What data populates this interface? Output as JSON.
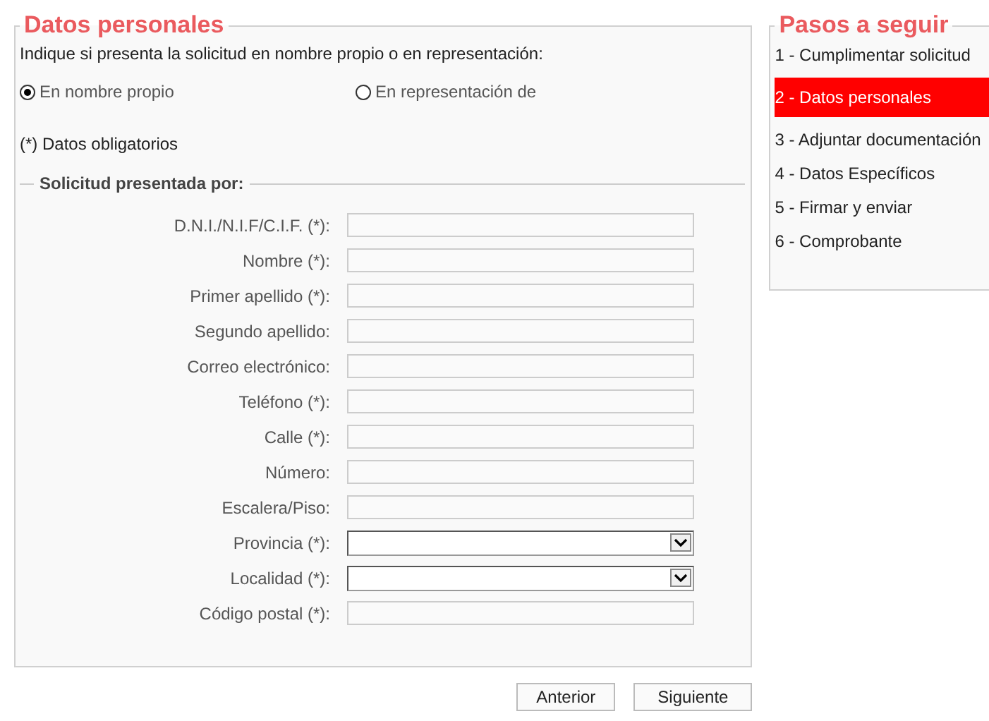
{
  "form": {
    "title": "Datos personales",
    "intro": "Indique si presenta la solicitud en nombre propio o en representación:",
    "options": [
      {
        "label": "En nombre propio",
        "selected": true
      },
      {
        "label": "En representación de",
        "selected": false
      }
    ],
    "required_note": "(*) Datos obligatorios",
    "section": {
      "title": "Solicitud presentada por:",
      "fields": [
        {
          "label": "D.N.I./N.I.F/C.I.F. (*):",
          "kind": "text"
        },
        {
          "label": "Nombre (*):",
          "kind": "text"
        },
        {
          "label": "Primer apellido (*):",
          "kind": "text"
        },
        {
          "label": "Segundo apellido:",
          "kind": "text"
        },
        {
          "label": "Correo electrónico:",
          "kind": "text"
        },
        {
          "label": "Teléfono (*):",
          "kind": "text"
        },
        {
          "label": "Calle (*):",
          "kind": "text"
        },
        {
          "label": "Número:",
          "kind": "text"
        },
        {
          "label": "Escalera/Piso:",
          "kind": "text"
        },
        {
          "label": "Provincia (*):",
          "kind": "select"
        },
        {
          "label": "Localidad (*):",
          "kind": "select"
        },
        {
          "label": "Código postal (*):",
          "kind": "text"
        }
      ]
    }
  },
  "buttons": [
    "Anterior",
    "Siguiente"
  ],
  "steps": {
    "title": "Pasos a seguir",
    "items": [
      {
        "label": "1 - Cumplimentar solicitud",
        "selected": false
      },
      {
        "label": "2 - Datos personales",
        "selected": true
      },
      {
        "label": "3 - Adjuntar documentación",
        "selected": false
      },
      {
        "label": "4 - Datos Específicos",
        "selected": false
      },
      {
        "label": "5 - Firmar y enviar",
        "selected": false
      },
      {
        "label": "6 - Comprobante",
        "selected": false
      }
    ]
  }
}
